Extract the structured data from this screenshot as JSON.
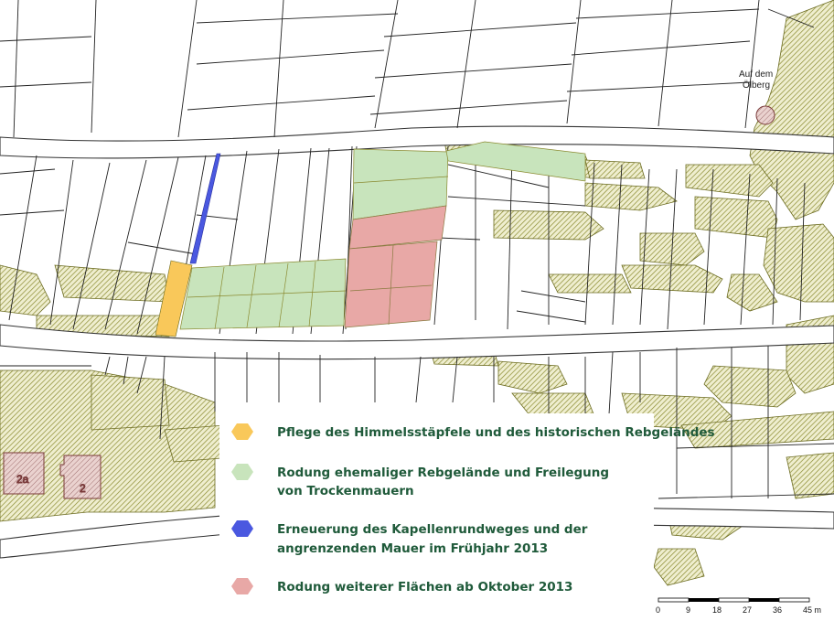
{
  "map": {
    "place_label_line1": "Auf dem",
    "place_label_line2": "Ölberg",
    "house_numbers": [
      "2a",
      "2"
    ]
  },
  "legend": {
    "items": [
      {
        "color": "#f9c85a",
        "line1": "Pflege des Himmelsstäpfele und des historischen Rebgeländes",
        "line2": ""
      },
      {
        "color": "#c8e4bc",
        "line1": "Rodung ehemaliger Rebgelände und Freilegung",
        "line2": "von Trockenmauern"
      },
      {
        "color": "#4a58e0",
        "line1": "Erneuerung des Kapellenrundweges und der",
        "line2": "angrenzenden Mauer im Frühjahr 2013"
      },
      {
        "color": "#e8a8a6",
        "line1": "Rodung weiterer Flächen ab Oktober 2013",
        "line2": ""
      }
    ]
  },
  "scalebar": {
    "ticks": [
      "0",
      "9",
      "18",
      "27",
      "36",
      "45 m"
    ]
  },
  "colors": {
    "hatch": "#8a8a30",
    "orange": "#f9c85a",
    "green": "#c8e4bc",
    "blue": "#4a58e0",
    "pink": "#e8a8a6",
    "building": "#e8c8c4",
    "legend_text": "#1f5a3a"
  }
}
